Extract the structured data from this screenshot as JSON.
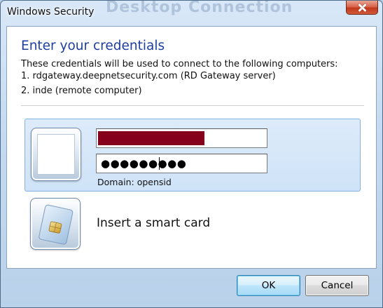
{
  "window": {
    "title": "Windows Security",
    "ghost_text": "Desktop Connection"
  },
  "dialog": {
    "heading": "Enter your credentials",
    "description": "These credentials will be used to connect to the following computers:",
    "computers": [
      "1. rdgateway.deepnetsecurity.com (RD Gateway server)",
      "2. inde (remote computer)"
    ]
  },
  "credential_tile": {
    "username_value": "",
    "username_redacted_color": "#85001a",
    "password_masked": "●●●●●●●●●",
    "domain_label": "Domain: opensid"
  },
  "smartcard_tile": {
    "label": "Insert a smart card",
    "icon": "smart-card-icon"
  },
  "buttons": {
    "ok": "OK",
    "cancel": "Cancel"
  },
  "colors": {
    "heading": "#1e3fa0",
    "selected_tile": "#d6e7fa",
    "close_button": "#c2371c"
  }
}
